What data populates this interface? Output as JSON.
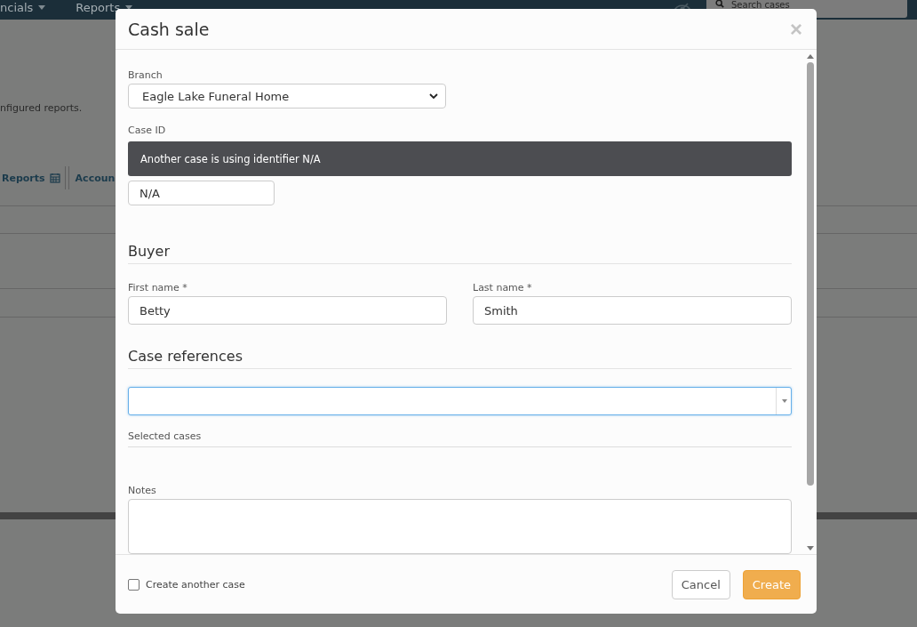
{
  "background": {
    "nav_items": [
      {
        "label": "ncials"
      },
      {
        "label": "Reports"
      }
    ],
    "search": {
      "placeholder": "Search cases"
    },
    "description": "nfigured reports.",
    "tabs": [
      {
        "label": "Reports",
        "kind": "calendar"
      },
      {
        "label": "Accoun",
        "kind": "plain"
      }
    ]
  },
  "dialog": {
    "title": "Cash sale",
    "close": "×",
    "branch": {
      "label": "Branch",
      "value": "Eagle Lake Funeral Home"
    },
    "case_id": {
      "label": "Case ID",
      "alert": "Another case is using identifier N/A",
      "value": "N/A"
    },
    "buyer": {
      "heading": "Buyer",
      "first_name": {
        "label": "First name *",
        "value": "Betty"
      },
      "last_name": {
        "label": "Last name *",
        "value": "Smith"
      }
    },
    "case_references": {
      "heading": "Case references",
      "focused": true,
      "selected_label": "Selected cases"
    },
    "notes": {
      "label": "Notes"
    },
    "create_another": {
      "label": "Create another case",
      "checked": false
    },
    "buttons": [
      {
        "label": "Cancel",
        "kind": "secondary"
      },
      {
        "label": "Create",
        "kind": "primary"
      }
    ]
  }
}
